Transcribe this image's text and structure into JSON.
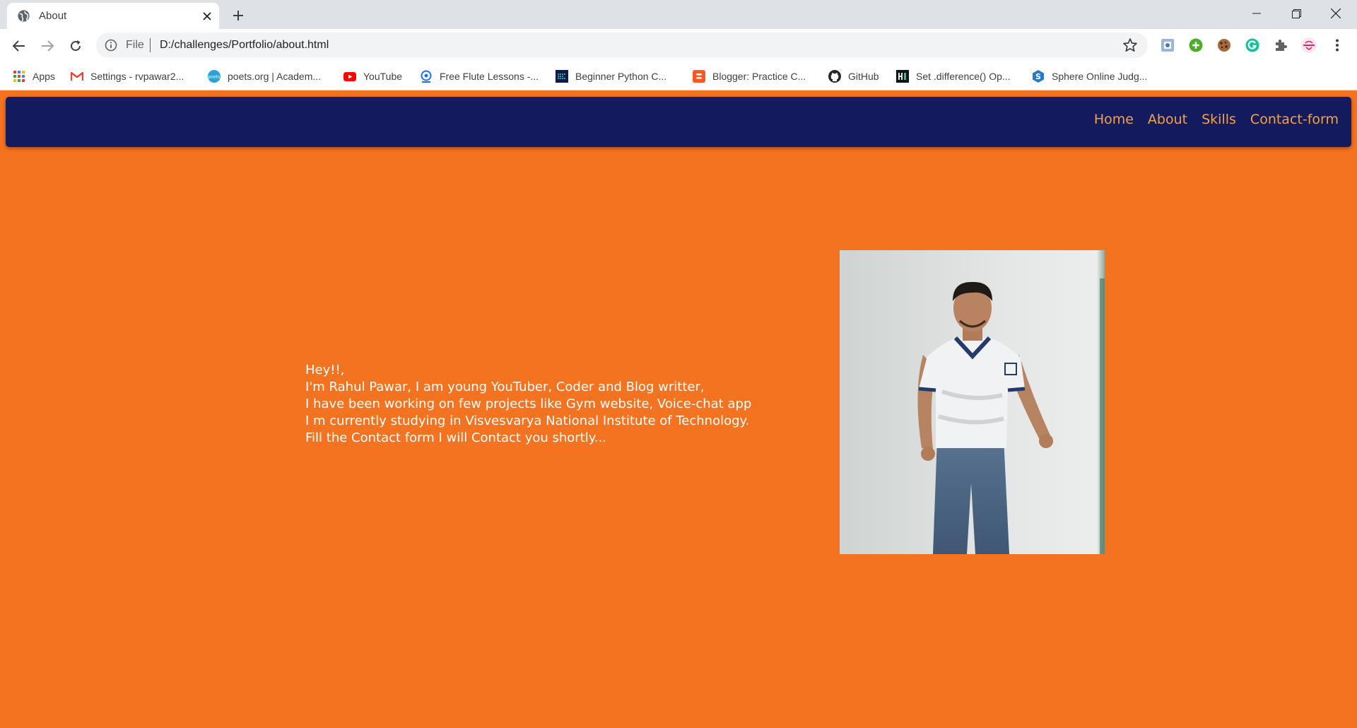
{
  "browser": {
    "tab_title": "About",
    "url_scheme": "File",
    "url": "D:/challenges/Portfolio/about.html",
    "bookmarks": [
      {
        "label": "Apps",
        "icon": "apps-grid-icon"
      },
      {
        "label": "Settings - rvpawar2...",
        "icon": "gmail-icon"
      },
      {
        "label": "poets.org | Academ...",
        "icon": "poets-org-icon"
      },
      {
        "label": "YouTube",
        "icon": "youtube-icon"
      },
      {
        "label": "Free Flute Lessons -...",
        "icon": "flute-lessons-icon"
      },
      {
        "label": "Beginner Python C...",
        "icon": "python-course-icon"
      },
      {
        "label": "Blogger: Practice C...",
        "icon": "blogger-icon"
      },
      {
        "label": "GitHub",
        "icon": "github-icon"
      },
      {
        "label": "Set .difference() Op...",
        "icon": "hackerrank-icon"
      },
      {
        "label": "Sphere Online Judg...",
        "icon": "spoj-icon"
      }
    ]
  },
  "nav": {
    "links": [
      "Home",
      "About",
      "Skills",
      "Contact-form"
    ]
  },
  "about": {
    "lines": [
      "Hey!!,",
      "I'm Rahul Pawar, I am young YouTuber, Coder and Blog writter,",
      "I have been working on few projects like Gym website, Voice-chat app",
      "I m currently studying in Visvesvarya National Institute of Technology.",
      "Fill the Contact form I will Contact you shortly..."
    ]
  },
  "colors": {
    "page_background": "#f47320",
    "navbar": "#131b5e",
    "nav_link": "#f3a341",
    "text": "#ffffff"
  }
}
